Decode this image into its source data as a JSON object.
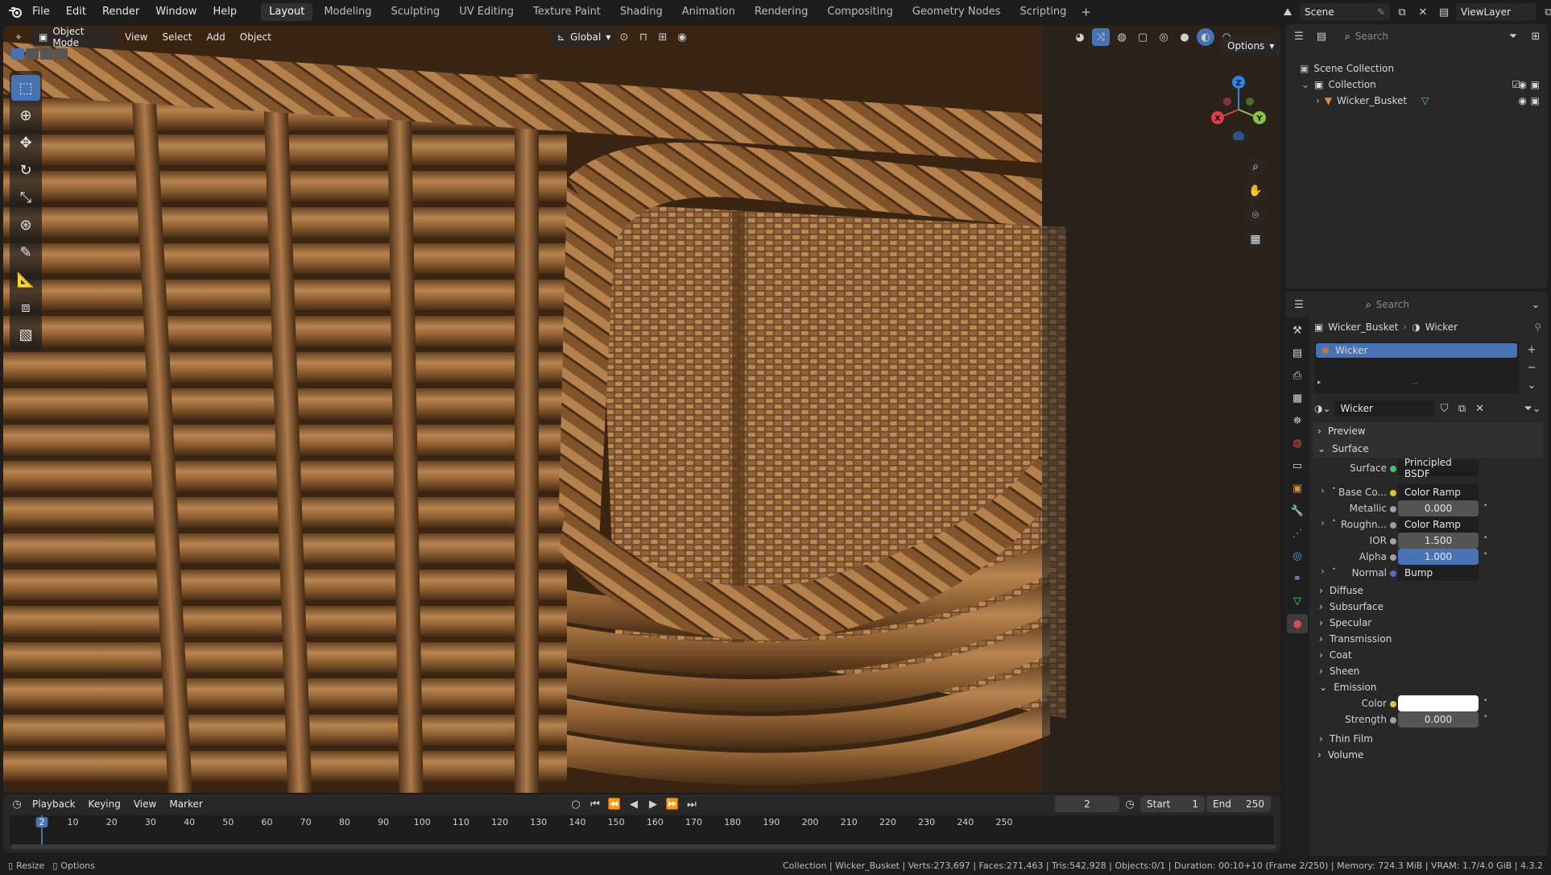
{
  "topbar": {
    "menus": [
      "File",
      "Edit",
      "Render",
      "Window",
      "Help"
    ],
    "workspaces": [
      "Layout",
      "Modeling",
      "Sculpting",
      "UV Editing",
      "Texture Paint",
      "Shading",
      "Animation",
      "Rendering",
      "Compositing",
      "Geometry Nodes",
      "Scripting"
    ],
    "active_workspace": "Layout",
    "scene": "Scene",
    "view_layer": "ViewLayer"
  },
  "viewport": {
    "mode": "Object Mode",
    "menus": [
      "View",
      "Select",
      "Add",
      "Object"
    ],
    "transform_orientation": "Global",
    "options_label": "Options",
    "gizmo_axes": {
      "x": "X",
      "y": "Y",
      "z": "Z"
    },
    "colors": {
      "x": "#e23a4e",
      "y": "#8bc53f",
      "z": "#2f83e6",
      "wicker_light": "#b07a44",
      "wicker_dark": "#5a3a1c"
    }
  },
  "outliner": {
    "search_placeholder": "Search",
    "scene_collection": "Scene Collection",
    "collection": "Collection",
    "object": "Wicker_Busket"
  },
  "properties": {
    "search_placeholder": "Search",
    "breadcrumb_object": "Wicker_Busket",
    "breadcrumb_material": "Wicker",
    "material_slot": "Wicker",
    "material_name": "Wicker",
    "panels": {
      "preview": "Preview",
      "surface": "Surface"
    },
    "surface_rows": [
      {
        "label": "Surface",
        "value": "Principled BSDF",
        "socket": "#44c36a"
      },
      {
        "label": "Base Co...",
        "value": "Color Ramp",
        "socket": "#d8c33a",
        "expand": true
      },
      {
        "label": "Metallic",
        "value": "0.000",
        "socket": "#a1a1a1",
        "numeric": true
      },
      {
        "label": "Roughn...",
        "value": "Color Ramp",
        "socket": "#a1a1a1",
        "expand": true
      },
      {
        "label": "IOR",
        "value": "1.500",
        "socket": "#a1a1a1",
        "numeric": true
      },
      {
        "label": "Alpha",
        "value": "1.000",
        "socket": "#a1a1a1",
        "numeric": true,
        "highlight": true
      },
      {
        "label": "Normal",
        "value": "Bump",
        "socket": "#6363c7",
        "expand": true
      }
    ],
    "subpanels": [
      "Diffuse",
      "Subsurface",
      "Specular",
      "Transmission",
      "Coat",
      "Sheen"
    ],
    "emission": {
      "label": "Emission",
      "color_label": "Color",
      "strength_label": "Strength",
      "strength": "0.000"
    },
    "thin_film": "Thin Film",
    "volume": "Volume"
  },
  "timeline": {
    "menus": [
      "Playback",
      "Keying",
      "View",
      "Marker"
    ],
    "current_frame": "2",
    "start_label": "Start",
    "start": "1",
    "end_label": "End",
    "end": "250",
    "ticks": [
      "2",
      "10",
      "20",
      "30",
      "40",
      "50",
      "60",
      "70",
      "80",
      "90",
      "100",
      "110",
      "120",
      "130",
      "140",
      "150",
      "160",
      "170",
      "180",
      "190",
      "200",
      "210",
      "220",
      "230",
      "240",
      "250"
    ]
  },
  "statusbar": {
    "left_a": "Resize",
    "left_b": "Options",
    "info": "Collection | Wicker_Busket | Verts:273,697 | Faces:271,463 | Tris:542,928 | Objects:0/1 | Duration: 00:10+10 (Frame 2/250) | Memory: 724.3 MiB | VRAM: 1.7/4.0 GiB | 4.3.2"
  }
}
